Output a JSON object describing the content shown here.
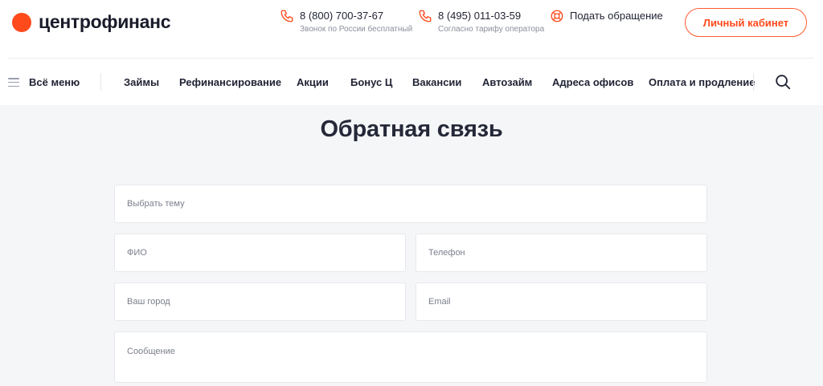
{
  "brand": {
    "name": "центрофинанс",
    "accent": "#ff4a1c"
  },
  "contacts": [
    {
      "icon": "phone-icon",
      "number": "8 (800) 700-37-67",
      "note": "Звонок по России бесплатный"
    },
    {
      "icon": "phone-icon",
      "number": "8 (495) 011-03-59",
      "note": "Согласно тарифу оператора"
    },
    {
      "icon": "lifebuoy-icon",
      "label": "Подать обращение"
    }
  ],
  "header": {
    "cabinet_label": "Личный кабинет"
  },
  "nav": {
    "menu_label": "Всё меню",
    "items": [
      "Займы",
      "Рефинансирование",
      "Акции",
      "Бонус Ц",
      "Вакансии",
      "Автозайм",
      "Адреса офисов",
      "Оплата и продление"
    ],
    "search_icon": "search-icon"
  },
  "page": {
    "title": "Обратная связь"
  },
  "form": {
    "topic_placeholder": "Выбрать тему",
    "fio_placeholder": "ФИО",
    "phone_placeholder": "Телефон",
    "city_placeholder": "Ваш город",
    "email_placeholder": "Email",
    "message_placeholder": "Сообщение"
  }
}
